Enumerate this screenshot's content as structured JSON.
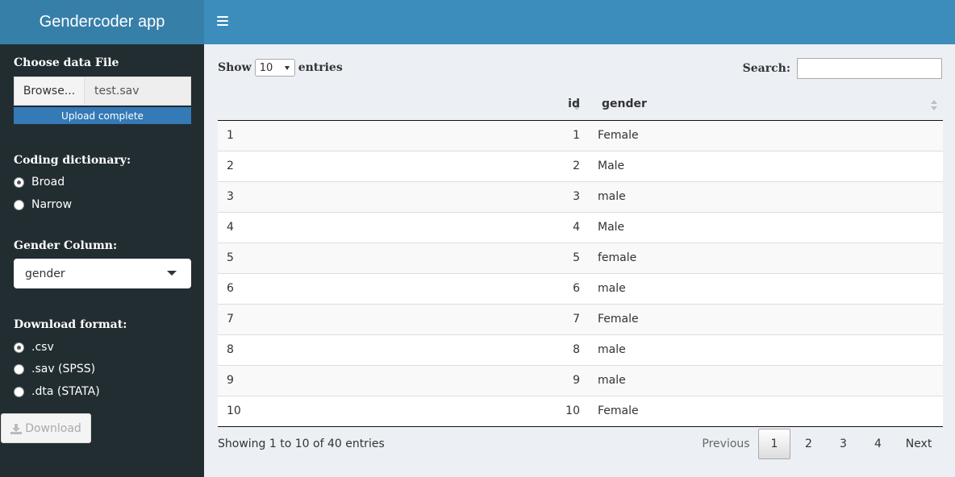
{
  "app": {
    "title": "Gendercoder app"
  },
  "sidebar": {
    "file": {
      "label": "Choose data File",
      "browse_label": "Browse...",
      "file_name": "test.sav",
      "status": "Upload complete"
    },
    "dictionary": {
      "label": "Coding dictionary:",
      "options": [
        "Broad",
        "Narrow"
      ],
      "selected": "Broad"
    },
    "gender_column": {
      "label": "Gender Column:",
      "value": "gender"
    },
    "download_format": {
      "label": "Download format:",
      "options": [
        ".csv",
        ".sav (SPSS)",
        ".dta (STATA)"
      ],
      "selected": ".csv"
    },
    "download_label": "Download"
  },
  "table_controls": {
    "show_label": "Show",
    "length_value": "10",
    "entries_label": "entries",
    "search_label": "Search:",
    "search_value": ""
  },
  "table": {
    "columns": [
      "",
      "id",
      "gender"
    ],
    "rows": [
      [
        "1",
        "1",
        "Female"
      ],
      [
        "2",
        "2",
        "Male"
      ],
      [
        "3",
        "3",
        "male"
      ],
      [
        "4",
        "4",
        "Male"
      ],
      [
        "5",
        "5",
        "female"
      ],
      [
        "6",
        "6",
        "male"
      ],
      [
        "7",
        "7",
        "Female"
      ],
      [
        "8",
        "8",
        "male"
      ],
      [
        "9",
        "9",
        "male"
      ],
      [
        "10",
        "10",
        "Female"
      ]
    ]
  },
  "footer": {
    "info": "Showing 1 to 10 of 40 entries",
    "previous": "Previous",
    "pages": [
      "1",
      "2",
      "3",
      "4"
    ],
    "current_page": "1",
    "next": "Next"
  }
}
